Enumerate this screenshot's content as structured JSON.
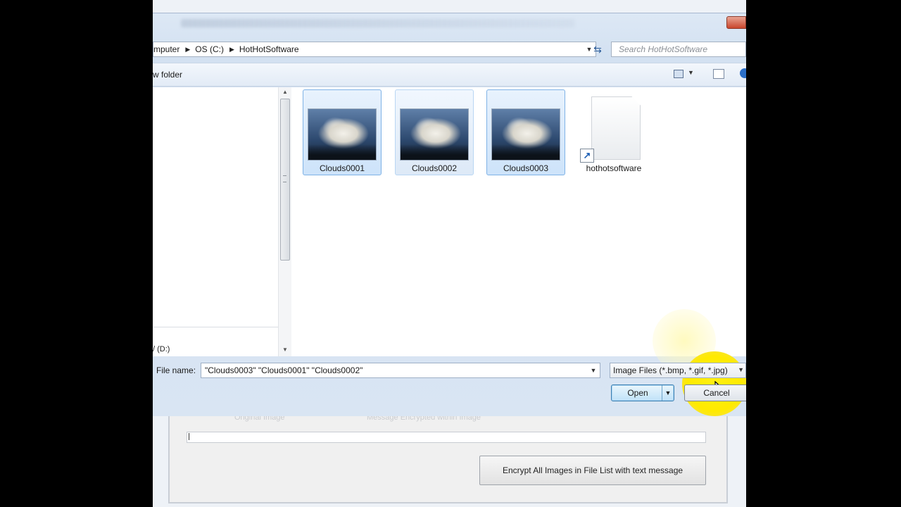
{
  "background_app": {
    "col_original": "Original Image",
    "col_encrypted": "Message Encrypted within Image",
    "encrypt_button": "Encrypt All Images in File List with text message"
  },
  "address": {
    "crumbs": [
      "mputer",
      "OS (C:)",
      "HotHotSoftware"
    ],
    "search_placeholder": "Search HotHotSoftware"
  },
  "toolbar": {
    "new_folder": "w folder"
  },
  "nav": {
    "drive_label": "/ (D:)"
  },
  "files": [
    {
      "name": "Clouds0001",
      "selected": true
    },
    {
      "name": "Clouds0002",
      "selected": true
    },
    {
      "name": "Clouds0003",
      "selected": true
    },
    {
      "name": "hothotsoftware",
      "type": "shortcut"
    }
  ],
  "footer": {
    "file_name_label": "File name:",
    "file_name_value": "\"Clouds0003\" \"Clouds0001\" \"Clouds0002\"",
    "filter": "Image Files (*.bmp, *.gif, *.jpg)",
    "open": "Open",
    "cancel": "Cancel"
  }
}
